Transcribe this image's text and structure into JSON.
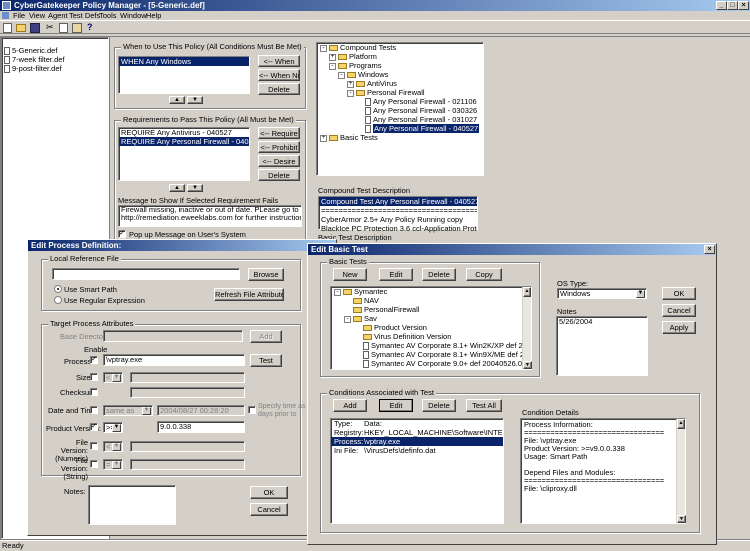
{
  "app": {
    "title": "CyberGatekeeper Policy Manager - [5-Generic.def]",
    "menu": [
      "File",
      "View",
      "Agent",
      "Test Defs",
      "Tools",
      "Window",
      "Help"
    ],
    "status": "Ready"
  },
  "files": [
    "5-Generic.def",
    "7-week filter.def",
    "9-post-filter.def"
  ],
  "when": {
    "label": "When to Use This Policy (All Conditions Must Be Met)",
    "items": [
      "WHEN Any Windows"
    ],
    "buttons": [
      "<-- When",
      "<-- When Not",
      "Delete"
    ]
  },
  "requirements": {
    "label": "Requirements to Pass This Policy (All Must be Met)",
    "items": [
      "REQUIRE Any Antivirus - 040527",
      "REQUIRE Any Personal Firewall - 040527"
    ],
    "buttons": [
      "<-- Require",
      "<-- Prohibit",
      "<-- Desire",
      "Delete"
    ]
  },
  "message": {
    "label": "Message to Show If Selected Requirement Fails",
    "text1": "Firewall missing, inactive or out of date.  PLease go to",
    "text2": "http://remediation.eweeklabs.com for further instructions.",
    "popup_label": "Pop up Message on User's System"
  },
  "tree": [
    {
      "label": "Compound Tests",
      "depth": 0,
      "pm": "-",
      "icon": "folder"
    },
    {
      "label": "Platform",
      "depth": 1,
      "pm": "+",
      "icon": "folder"
    },
    {
      "label": "Programs",
      "depth": 1,
      "pm": "-",
      "icon": "folder"
    },
    {
      "label": "Windows",
      "depth": 2,
      "pm": "-",
      "icon": "folder"
    },
    {
      "label": "AntiVirus",
      "depth": 3,
      "pm": "+",
      "icon": "folder"
    },
    {
      "label": "Personal Firewall",
      "depth": 3,
      "pm": "-",
      "icon": "folder"
    },
    {
      "label": "Any Personal Firewall - 021106",
      "depth": 4,
      "pm": "",
      "icon": "doc"
    },
    {
      "label": "Any Personal Firewall - 030326",
      "depth": 4,
      "pm": "",
      "icon": "doc"
    },
    {
      "label": "Any Personal Firewall - 031027",
      "depth": 4,
      "pm": "",
      "icon": "doc"
    },
    {
      "label": "Any Personal Firewall - 040527",
      "depth": 4,
      "pm": "",
      "icon": "doc",
      "selected": true
    },
    {
      "label": "Basic Tests",
      "depth": 0,
      "pm": "+",
      "icon": "folder"
    }
  ],
  "compound_desc": {
    "label": "Compound Test Description",
    "lines": [
      "Compound Test Any Personal Firewall - 040527",
      "======================================",
      "CyberArmor 2.5+ Any Policy Running copy",
      "BlackIce PC Protection 3.6 ccl-Application Protection Enab",
      "Computer Associates EZ Firewall 5.5 build 3525"
    ],
    "basic_desc_label": "Basic Test Description"
  },
  "process_dialog": {
    "title": "Edit Process Definition:",
    "local_ref_label": "Local Reference File",
    "browse": "Browse",
    "radio_smart": "Use Smart Path",
    "radio_regex": "Use Regular Expression",
    "refresh": "Refresh File Attributes",
    "target_label": "Target Process Attributes",
    "base_dir_label": "Base Directory",
    "add": "Add",
    "enable_label": "Enable",
    "process_label": "Process:",
    "process_value": "\\vptray.exe",
    "test_btn": "Test",
    "size_label": "Size:",
    "size_op": "<",
    "checksum_label": "Checksum:",
    "date_label": "Date and Time:",
    "date_op": "same as",
    "date_value": "2004/08/27 00:28:20",
    "specify_label": "Specify time as days prior to audit",
    "version_label": "Product Version:",
    "version_op": ">=",
    "version_value": "9.0.0.338",
    "file_num_label": "File Version: (Numeric)",
    "file_num_op": "<",
    "file_str_label": "File Version: (String)",
    "file_str_op": "=",
    "notes_label": "Notes:",
    "ok": "OK",
    "cancel": "Cancel"
  },
  "basic_dialog": {
    "title": "Edit Basic Test",
    "basic_tests_label": "Basic Tests",
    "buttons": [
      "New",
      "Edit",
      "Delete",
      "Copy"
    ],
    "tree": [
      {
        "label": "Symantec",
        "depth": 0,
        "pm": "-",
        "icon": "folder"
      },
      {
        "label": "NAV",
        "depth": 1,
        "pm": "",
        "icon": "folder"
      },
      {
        "label": "PersonalFirewall",
        "depth": 1,
        "pm": "",
        "icon": "folder"
      },
      {
        "label": "Sav",
        "depth": 1,
        "pm": "-",
        "icon": "folder"
      },
      {
        "label": "Product Version",
        "depth": 2,
        "pm": "",
        "icon": "folder"
      },
      {
        "label": "Virus Definition Version",
        "depth": 2,
        "pm": "",
        "icon": "folder"
      },
      {
        "label": "Symantec AV Corporate 8.1+ Win2K/XP def 20040526",
        "depth": 2,
        "pm": "",
        "icon": "doc"
      },
      {
        "label": "Symantec AV Corporate 8.1+ Win9X/ME def 20040526",
        "depth": 2,
        "pm": "",
        "icon": "doc"
      },
      {
        "label": "Symantec AV Corporate 9.0+ def 20040526.019",
        "depth": 2,
        "pm": "",
        "icon": "doc"
      }
    ],
    "os_type_label": "OS Type:",
    "os_type_value": "Windows",
    "ok": "OK",
    "cancel": "Cancel",
    "apply": "Apply",
    "notes_label": "Notes",
    "notes_value": "5/26/2004",
    "conditions_label": "Conditions Associated with Test",
    "cond_buttons": [
      "Add",
      "Edit",
      "Delete",
      "Test All"
    ],
    "cond_headers": [
      "Type:",
      "Data:"
    ],
    "cond_rows": [
      [
        "Registry:",
        "HKEY_LOCAL_MACHINE\\Software\\INTEL\\L..."
      ],
      [
        "Process:",
        "\\vptray.exe"
      ],
      [
        "Ini File:",
        "\\VirusDefs\\definfo.dat"
      ]
    ],
    "cond_details_label": "Condition Details",
    "details_lines": [
      "Process Information:",
      "================================",
      "File: \\vptray.exe",
      "Product Version: >=v9.0.0.338",
      "Usage: Smart Path",
      "",
      "Depend Files and Modules:",
      "================================",
      "File: \\cliproxy.dll"
    ]
  }
}
